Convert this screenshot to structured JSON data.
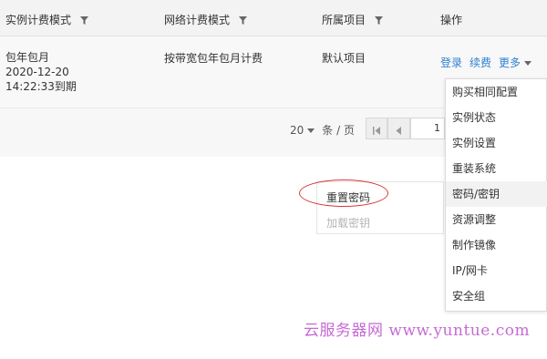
{
  "table": {
    "headers": [
      {
        "label": "实例计费模式",
        "filter": true
      },
      {
        "label": "网络计费模式",
        "filter": true
      },
      {
        "label": "所属项目",
        "filter": true
      },
      {
        "label": "操作",
        "filter": false
      }
    ],
    "row": {
      "instance_billing": "包年包月",
      "expire_date": "2020-12-20",
      "expire_time": "14:22:33到期",
      "network_billing": "按带宽包年包月计费",
      "project": "默认项目",
      "actions": {
        "login": "登录",
        "renew": "续费",
        "more": "更多"
      }
    }
  },
  "pagination": {
    "page_size": "20",
    "per_page_label": "条 / 页",
    "current_page": "1"
  },
  "submenu": {
    "reset_password": "重置密码",
    "load_key": "加载密钥"
  },
  "more_menu": {
    "items": [
      "购买相同配置",
      "实例状态",
      "实例设置",
      "重装系统",
      "密码/密钥",
      "资源调整",
      "制作镜像",
      "IP/网卡",
      "安全组"
    ],
    "active_index": 4
  },
  "watermark": "云服务器网 www.yuntue.com",
  "colors": {
    "link": "#2f7fd3",
    "highlight_circle": "#d9363e",
    "watermark": "#c56bd3"
  }
}
